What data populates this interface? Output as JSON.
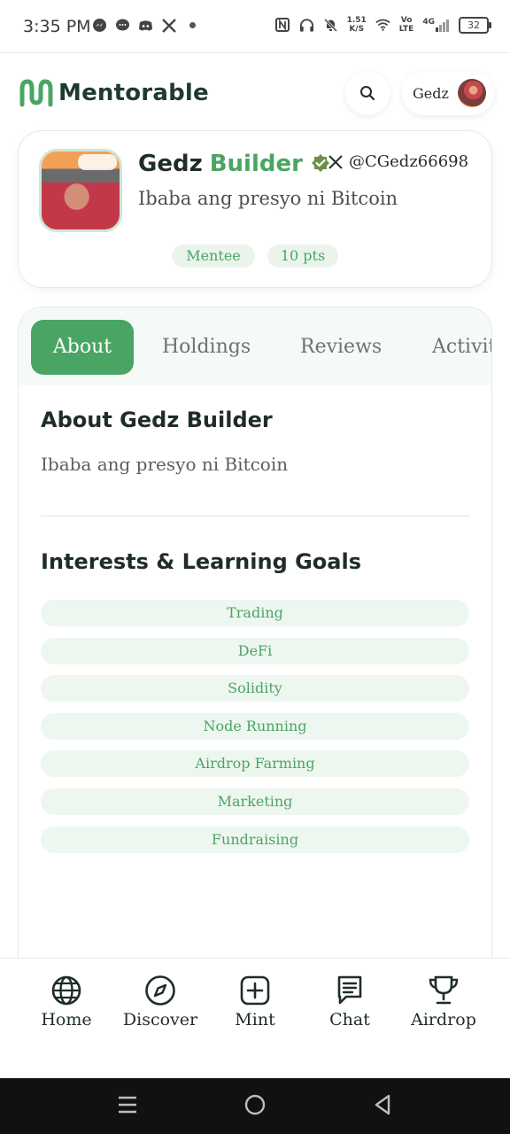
{
  "status_bar": {
    "time": "3:35 PM",
    "speed_value": "1.51",
    "speed_unit": "K/S",
    "volte_top": "Vo",
    "volte_bottom": "LTE",
    "network": "4G",
    "battery": "32"
  },
  "header": {
    "logo_text": "Mentorable",
    "user_name": "Gedz",
    "brand_color": "#4aa564"
  },
  "profile": {
    "first_name": "Gedz",
    "last_name": "Builder",
    "x_handle": "@CGedz66698",
    "bio": "Ibaba ang presyo ni Bitcoin",
    "role_badge": "Mentee",
    "points_badge": "10 pts"
  },
  "tabs": [
    "About",
    "Holdings",
    "Reviews",
    "Activity"
  ],
  "about": {
    "title": "About Gedz Builder",
    "text": "Ibaba ang presyo ni Bitcoin"
  },
  "interests": {
    "title": "Interests & Learning Goals",
    "items": [
      "Trading",
      "DeFi",
      "Solidity",
      "Node Running",
      "Airdrop Farming",
      "Marketing",
      "Fundraising"
    ]
  },
  "bottom_nav": [
    {
      "label": "Home",
      "icon": "globe-icon"
    },
    {
      "label": "Discover",
      "icon": "compass-icon"
    },
    {
      "label": "Mint",
      "icon": "plus-square-icon"
    },
    {
      "label": "Chat",
      "icon": "chat-icon"
    },
    {
      "label": "Airdrop",
      "icon": "trophy-icon"
    }
  ]
}
